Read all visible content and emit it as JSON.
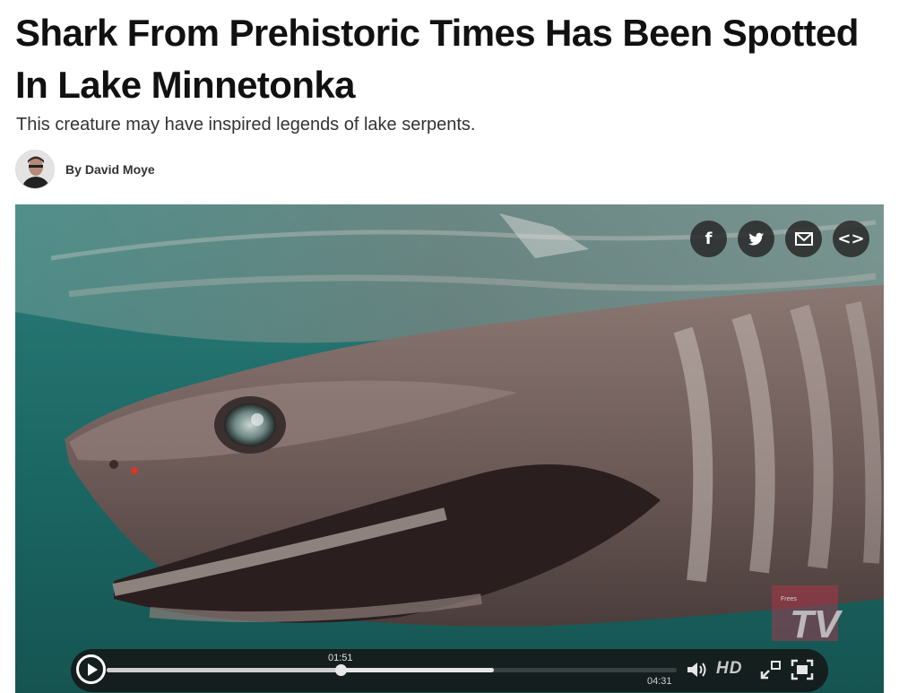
{
  "article": {
    "headline": "Shark From Prehistoric Times Has Been Spotted In Lake Minnetonka",
    "subheadline": "This creature may have inspired legends of lake serpents.",
    "byline_prefix": "By",
    "author": "David Moye"
  },
  "video": {
    "share_buttons": [
      {
        "icon": "facebook-icon",
        "glyph": "f"
      },
      {
        "icon": "twitter-icon",
        "glyph": "🐦"
      },
      {
        "icon": "email-icon",
        "glyph": "✉"
      },
      {
        "icon": "embed-icon",
        "glyph": "<>"
      }
    ],
    "current_time": "01:51",
    "duration": "04:31",
    "played_fraction": 0.41,
    "buffered_fraction": 0.68,
    "quality_label": "HD",
    "logo_text": "TV",
    "logo_small_text": "Frees"
  },
  "colors": {
    "water": "#1f6a67",
    "shark": "#7d6a66",
    "controls_bg": "#161a1a",
    "logo": "#c9324a"
  }
}
